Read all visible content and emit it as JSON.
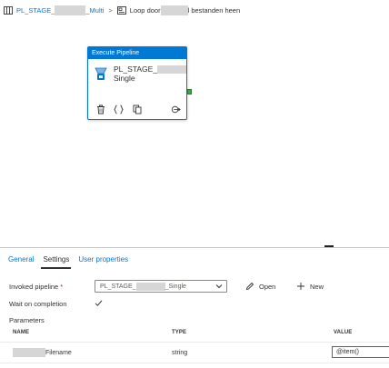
{
  "breadcrumb": {
    "pipeline_prefix": "PL_STAGE_",
    "pipeline_suffix": "_Multi",
    "separator": ">",
    "activity_prefix": "Loop door ",
    "activity_suffix": "l bestanden heen"
  },
  "activity": {
    "header": "Execute Pipeline",
    "name_prefix": "PL_STAGE_",
    "name_suffix": "Single",
    "icons": [
      "delete-icon",
      "code-icon",
      "copy-icon",
      "add-output-icon"
    ]
  },
  "panel": {
    "tabs": [
      {
        "label": "General",
        "active": false
      },
      {
        "label": "Settings",
        "active": true
      },
      {
        "label": "User properties",
        "active": false
      }
    ],
    "invoked_pipeline_label": "Invoked pipeline",
    "required_marker": "*",
    "invoked_pipeline_value_prefix": "PL_STAGE_",
    "invoked_pipeline_value_suffix": "_Single",
    "open_label": "Open",
    "new_label": "New",
    "wait_on_completion_label": "Wait on completion",
    "wait_on_completion_checked": true,
    "parameters_label": "Parameters"
  },
  "parameters_table": {
    "columns": [
      "NAME",
      "TYPE",
      "VALUE"
    ],
    "rows": [
      {
        "name_suffix": "Filename",
        "type": "string",
        "value": "@item()"
      }
    ]
  },
  "colors": {
    "accent": "#0078d4",
    "success": "#3fa54a",
    "required": "#a4262c"
  }
}
